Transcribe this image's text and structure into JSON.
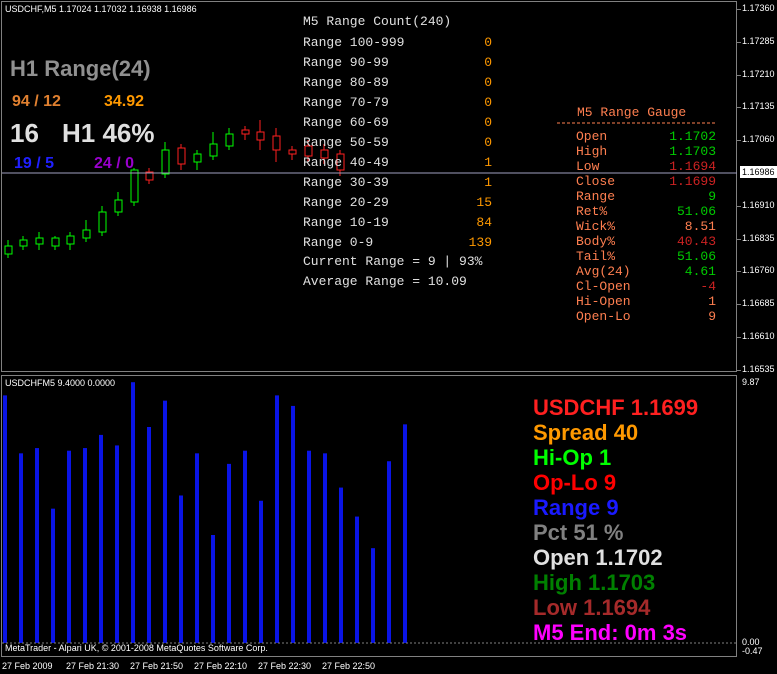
{
  "main": {
    "symbol_header": "USDCHF,M5  1.17024 1.17032 1.16938 1.16986",
    "h1_range_title": "H1 Range(24)",
    "h1_counts": "94 / 12",
    "h1_avg": "34.92",
    "h1_now": "16",
    "h1_pct": "H1 46%",
    "h1_bull": "19 / 5",
    "h1_bear": "24 / 0",
    "price_ticks": [
      "1.17360",
      "1.17285",
      "1.17210",
      "1.17135",
      "1.17060",
      "1.16986",
      "1.16910",
      "1.16835",
      "1.16760",
      "1.16685",
      "1.16610",
      "1.16535"
    ],
    "current_price": "1.16986"
  },
  "range_count": {
    "title": "M5 Range Count(240)",
    "rows": [
      {
        "label": "Range 100-999",
        "count": "0"
      },
      {
        "label": "Range 90-99",
        "count": "0"
      },
      {
        "label": "Range 80-89",
        "count": "0"
      },
      {
        "label": "Range 70-79",
        "count": "0"
      },
      {
        "label": "Range 60-69",
        "count": "0"
      },
      {
        "label": "Range 50-59",
        "count": "0"
      },
      {
        "label": "Range 40-49",
        "count": "1"
      },
      {
        "label": "Range 30-39",
        "count": "1"
      },
      {
        "label": "Range 20-29",
        "count": "15"
      },
      {
        "label": "Range 10-19",
        "count": "84"
      },
      {
        "label": "Range 0-9",
        "count": "139"
      }
    ],
    "current": "Current Range = 9 | 93%",
    "average": "Average Range = 10.09"
  },
  "gauge": {
    "title": "M5 Range Gauge",
    "rows": [
      {
        "label": "Open",
        "value": "1.1702",
        "color": "#00cc00"
      },
      {
        "label": "High",
        "value": "1.1703",
        "color": "#00cc00"
      },
      {
        "label": "Low",
        "value": "1.1694",
        "color": "#cc2222"
      },
      {
        "label": "Close",
        "value": "1.1699",
        "color": "#cc2222"
      },
      {
        "label": "Range",
        "value": "9",
        "color": "#00cc00"
      },
      {
        "label": "Ret%",
        "value": "51.06",
        "color": "#00cc00"
      },
      {
        "label": "Wick%",
        "value": "8.51",
        "color": "#ff7f50"
      },
      {
        "label": "Body%",
        "value": "40.43",
        "color": "#cc2222"
      },
      {
        "label": "Tail%",
        "value": "51.06",
        "color": "#00cc00"
      },
      {
        "label": "Avg(24)",
        "value": "4.61",
        "color": "#00cc00"
      },
      {
        "label": "Cl-Open",
        "value": "-4",
        "color": "#cc2222"
      },
      {
        "label": "Hi-Open",
        "value": "1",
        "color": "#ff7f50"
      },
      {
        "label": "Open-Lo",
        "value": "9",
        "color": "#ff7f50"
      }
    ]
  },
  "sub": {
    "header": "USDCHFM5 9.4000 0.0000",
    "axis_top": "9.87",
    "axis_zero": "0.00",
    "axis_bottom": "-0.47",
    "copyright": "MetaTrader - Alpari UK, © 2001-2008 MetaQuotes Software Corp.",
    "bar_values": [
      9.4,
      7.2,
      7.4,
      5.1,
      7.3,
      7.4,
      7.9,
      7.5,
      9.9,
      8.2,
      9.2,
      5.6,
      7.2,
      4.1,
      6.8,
      7.3,
      5.4,
      9.4,
      9.0,
      7.3,
      7.2,
      5.9,
      4.8,
      3.6,
      6.9,
      8.3
    ],
    "info_lines": [
      {
        "text": "USDCHF 1.1699",
        "color": "#ff2020"
      },
      {
        "text": "Spread 40",
        "color": "#ff9900"
      },
      {
        "text": "Hi-Op 1",
        "color": "#00ff00"
      },
      {
        "text": "Op-Lo 9",
        "color": "#ff0000"
      },
      {
        "text": "Range 9",
        "color": "#1a1aff"
      },
      {
        "text": "Pct 51 %",
        "color": "#808080"
      },
      {
        "text": "Open 1.1702",
        "color": "#e0e0e0"
      },
      {
        "text": "High 1.1703",
        "color": "#008000"
      },
      {
        "text": "Low 1.1694",
        "color": "#a52a2a"
      },
      {
        "text": "M5 End: 0m 3s",
        "color": "#ff00ff"
      }
    ]
  },
  "time_axis": [
    "27 Feb 2009",
    "27 Feb 21:30",
    "27 Feb 21:50",
    "27 Feb 22:10",
    "27 Feb 22:30",
    "27 Feb 22:50"
  ]
}
